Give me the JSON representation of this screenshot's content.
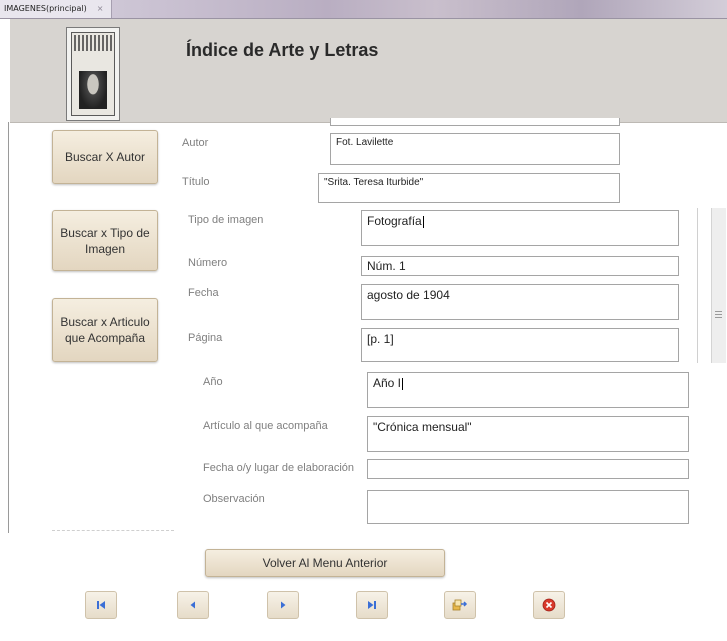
{
  "window": {
    "tab_title": "IMAGENES(principal)",
    "tab_close": "×"
  },
  "header": {
    "title": "Índice de Arte y Letras"
  },
  "sidebar": {
    "buttons": [
      {
        "label": "Buscar X Autor"
      },
      {
        "label": "Buscar x Tipo de Imagen"
      },
      {
        "label": "Buscar x Articulo que Acompaña"
      }
    ]
  },
  "form": {
    "autor": {
      "label": "Autor",
      "value": "Fot. Lavilette"
    },
    "titulo": {
      "label": "Título",
      "value": "\"Srita. Teresa Iturbide\""
    },
    "tipo_imagen": {
      "label": "Tipo de imagen",
      "value": "Fotografía"
    },
    "numero": {
      "label": "Número",
      "value": "Núm. 1"
    },
    "fecha": {
      "label": "Fecha",
      "value": "agosto de 1904"
    },
    "pagina": {
      "label": "Página",
      "value": "[p. 1]"
    },
    "anio": {
      "label": "Año",
      "value": "Año I"
    },
    "articulo": {
      "label": "Artículo al que acompaña",
      "value": "\"Crónica mensual\""
    },
    "fecha_lugar": {
      "label": "Fecha o/y lugar de elaboración",
      "value": ""
    },
    "observacion": {
      "label": "Observación",
      "value": ""
    }
  },
  "footer": {
    "back_label": "Volver Al Menu Anterior",
    "nav": [
      {
        "icon": "first-record-icon"
      },
      {
        "icon": "previous-record-icon"
      },
      {
        "icon": "next-record-icon"
      },
      {
        "icon": "last-record-icon"
      },
      {
        "icon": "export-icon"
      },
      {
        "icon": "close-icon"
      }
    ]
  },
  "colors": {
    "button_face": "#ecE2d0",
    "header_bg": "#d7d4d0",
    "nav_icon": "#3b6fd6",
    "close_red": "#d8392b"
  }
}
